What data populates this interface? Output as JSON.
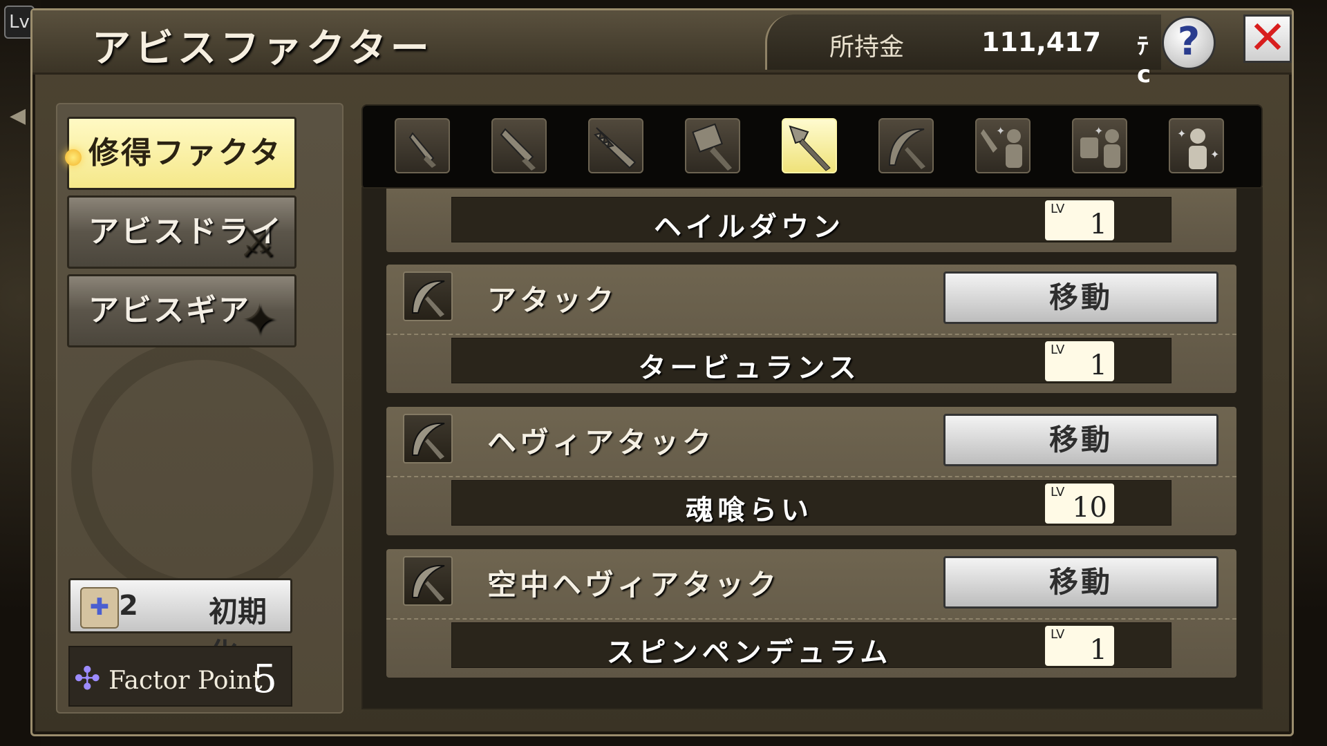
{
  "window": {
    "title": "アビスファクター",
    "money_label": "所持金",
    "money_value": "111,417",
    "money_unit": "ﾃc",
    "help_label": "?",
    "close_label": "✕"
  },
  "edge": {
    "lv_tab": "Lv"
  },
  "menu": {
    "items": [
      {
        "label": "修得ファクター",
        "active": true
      },
      {
        "label": "アビスドライブ",
        "active": false
      },
      {
        "label": "アビスギア",
        "active": false
      }
    ]
  },
  "reset": {
    "count": "2",
    "label": "初期化"
  },
  "factor_point": {
    "label": "Factor Point",
    "value": "5"
  },
  "weapon_tabs": [
    {
      "icon": "dagger-icon",
      "active": false
    },
    {
      "icon": "sword-icon",
      "active": false
    },
    {
      "icon": "serrated-blade-icon",
      "active": false
    },
    {
      "icon": "hammer-icon",
      "active": false
    },
    {
      "icon": "spear-icon",
      "active": true
    },
    {
      "icon": "scythe-icon",
      "active": false
    },
    {
      "icon": "weapon-skill-person-icon",
      "active": false
    },
    {
      "icon": "armor-skill-person-icon",
      "active": false
    },
    {
      "icon": "character-skill-person-icon",
      "active": false
    }
  ],
  "factors": [
    {
      "name": "",
      "sub": "ヘイルダウン",
      "lv_label": "LV",
      "lv": "1",
      "partial": true
    },
    {
      "name": "アタック",
      "move": "移動",
      "sub": "タービュランス",
      "lv_label": "LV",
      "lv": "1"
    },
    {
      "name": "ヘヴィアタック",
      "move": "移動",
      "sub": "魂喰らい",
      "lv_label": "LV",
      "lv": "10"
    },
    {
      "name": "空中ヘヴィアタック",
      "move": "移動",
      "sub": "スピンペンデュラム",
      "lv_label": "LV",
      "lv": "1"
    }
  ],
  "colors": {
    "active_tab": "#f5e88a",
    "panel": "#5a5242",
    "close_x": "#d81e1e",
    "help_q": "#2a3c8e"
  }
}
